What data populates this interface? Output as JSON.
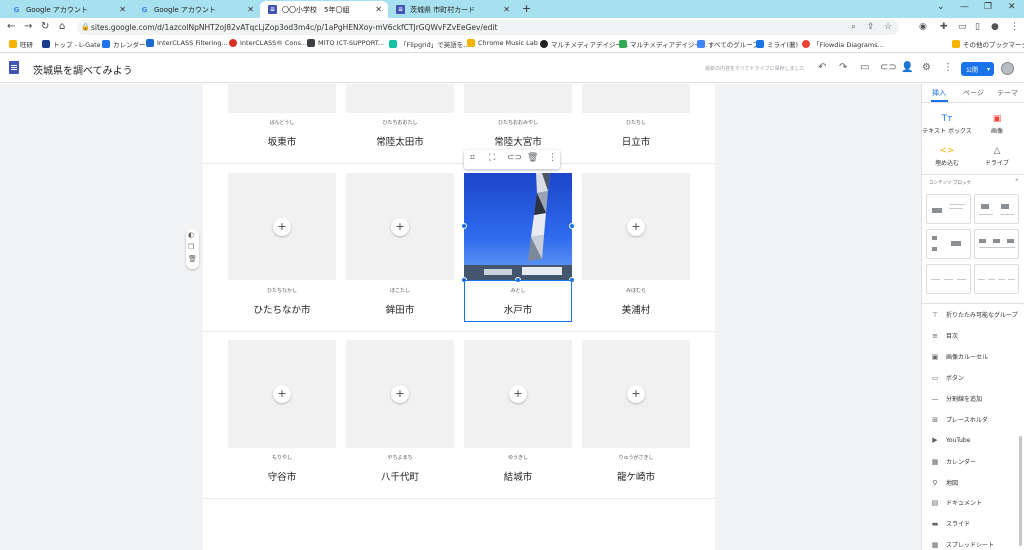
{
  "browser": {
    "tabs": [
      {
        "label": "Google アカウント",
        "icon": "google-icon"
      },
      {
        "label": "Google アカウント",
        "icon": "google-icon"
      },
      {
        "label": "〇〇小学校　5年〇組",
        "icon": "sites-icon"
      },
      {
        "label": "茨城県 市町村カード",
        "icon": "sites-icon"
      }
    ],
    "url": "sites.google.com/d/1azcolNpNHT2oJ82vATqcLjZop3od3m4c/p/1aPgHENXoy-mV6ckfCTJrGQWvFZvEeGev/edit",
    "bookmarks": [
      {
        "label": "旺研",
        "color": "#f4b400"
      },
      {
        "label": "トップ - L-Gate",
        "color": "#1a3e8c"
      },
      {
        "label": "カレンダー",
        "color": "#1a73e8"
      },
      {
        "label": "InterCLASS Filtering...",
        "color": "#1967d2"
      },
      {
        "label": "InterCLASS® Cons...",
        "color": "#d93025"
      },
      {
        "label": "MITO ICT-SUPPORT...",
        "color": "#3c4043"
      },
      {
        "label": "「Flipgrid」で英語を...",
        "color": "#16c1a3"
      },
      {
        "label": "Chrome Music Lab",
        "color": "#f4b400"
      },
      {
        "label": "マルチメディアデイジー...",
        "color": "#202124"
      },
      {
        "label": "マルチメディアデイジー...",
        "color": "#34a853"
      },
      {
        "label": "すべてのグループ",
        "color": "#4285f4"
      },
      {
        "label": "ミライ(著)",
        "color": "#1a73e8"
      },
      {
        "label": "「Flowdia Diagrams...",
        "color": "#ea4335"
      },
      {
        "label": "その他のブックマーク",
        "color": "#f4b400"
      }
    ]
  },
  "sites_header": {
    "title": "茨城県を調べてみよう",
    "save_status": "最新の内容をすべてドライブに保存しました",
    "publish_label": "公開"
  },
  "grid": {
    "row1": [
      {
        "reading": "ばんどうし",
        "name": "坂東市"
      },
      {
        "reading": "ひたちおおたし",
        "name": "常陸太田市"
      },
      {
        "reading": "ひたちおおみやし",
        "name": "常陸大宮市"
      },
      {
        "reading": "ひたちし",
        "name": "日立市"
      }
    ],
    "row2": [
      {
        "reading": "ひたちなかし",
        "name": "ひたちなか市"
      },
      {
        "reading": "ほこたし",
        "name": "鉾田市"
      },
      {
        "reading": "みとし",
        "name": "水戸市"
      },
      {
        "reading": "みほむら",
        "name": "美浦村"
      }
    ],
    "row3": [
      {
        "reading": "もりやし",
        "name": "守谷市"
      },
      {
        "reading": "やちよまち",
        "name": "八千代町"
      },
      {
        "reading": "ゆうきし",
        "name": "結城市"
      },
      {
        "reading": "りゅうがさきし",
        "name": "龍ケ崎市"
      }
    ]
  },
  "panel": {
    "tabs": [
      "挿入",
      "ページ",
      "テーマ"
    ],
    "insert_buttons": [
      {
        "label": "テキスト ボックス",
        "icon": "text-box-icon"
      },
      {
        "label": "画像",
        "icon": "image-icon"
      },
      {
        "label": "埋め込む",
        "icon": "embed-icon"
      },
      {
        "label": "ドライブ",
        "icon": "drive-icon"
      }
    ],
    "content_blocks_label": "コンテンツ ブロック",
    "items": [
      {
        "label": "折りたたみ可能なグループ",
        "icon": "collapsible-group-icon"
      },
      {
        "label": "目次",
        "icon": "table-of-contents-icon"
      },
      {
        "label": "画像カルーセル",
        "icon": "image-carousel-icon"
      },
      {
        "label": "ボタン",
        "icon": "button-icon"
      },
      {
        "label": "分割線を追加",
        "icon": "divider-icon"
      },
      {
        "label": "プレースホルダ",
        "icon": "placeholder-icon"
      },
      {
        "label": "YouTube",
        "icon": "youtube-icon"
      },
      {
        "label": "カレンダー",
        "icon": "calendar-icon"
      },
      {
        "label": "地図",
        "icon": "map-icon"
      },
      {
        "label": "ドキュメント",
        "icon": "docs-icon"
      },
      {
        "label": "スライド",
        "icon": "slides-icon"
      },
      {
        "label": "スプレッドシート",
        "icon": "sheets-icon"
      }
    ]
  }
}
